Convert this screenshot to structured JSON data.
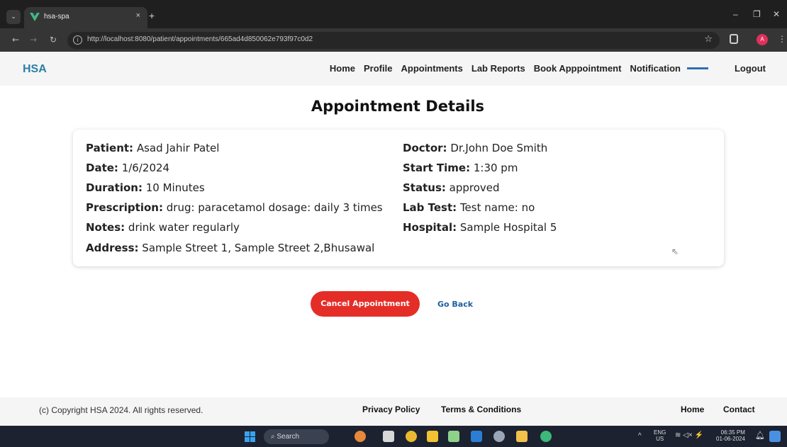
{
  "browser": {
    "tab_title": "hsa-spa",
    "tab_close": "×",
    "new_tab": "+",
    "url": "http://localhost:8080/patient/appointments/665ad4d850062e793f97c0d2",
    "profile_initial": "A",
    "accent_favicon": "#41b883"
  },
  "navbar": {
    "brand": "HSA",
    "links": {
      "home": "Home",
      "profile": "Profile",
      "appointments": "Appointments",
      "lab_reports": "Lab Reports",
      "book": "Book Apppointment",
      "notification": "Notification",
      "logout": "Logout"
    }
  },
  "page": {
    "title": "Appointment Details"
  },
  "details": {
    "patient_label": "Patient:",
    "patient": "Asad Jahir Patel",
    "date_label": "Date:",
    "date": "1/6/2024",
    "duration_label": "Duration:",
    "duration": "10 Minutes",
    "prescription_label": "Prescription:",
    "prescription": "drug: paracetamol dosage: daily 3 times",
    "notes_label": "Notes:",
    "notes": "drink water regularly",
    "address_label": "Address:",
    "address": "Sample Street 1, Sample Street 2,Bhusawal",
    "doctor_label": "Doctor:",
    "doctor": "Dr.John Doe Smith",
    "start_time_label": "Start Time:",
    "start_time": "1:30 pm",
    "status_label": "Status:",
    "status": "approved",
    "lab_test_label": "Lab Test:",
    "lab_test": "Test name: no",
    "hospital_label": "Hospital:",
    "hospital": "Sample Hospital 5"
  },
  "actions": {
    "cancel": "Cancel Appointment",
    "back": "Go Back"
  },
  "footer": {
    "copyright": "(c) Copyright HSA 2024. All rights reserved.",
    "privacy": "Privacy Policy",
    "terms": "Terms & Conditions",
    "home": "Home",
    "contact": "Contact"
  },
  "taskbar": {
    "search": "Search",
    "lang_1": "ENG",
    "lang_2": "US",
    "time": "06:35 PM",
    "date": "01-06-2024"
  },
  "colors": {
    "brand": "#2a7fa6",
    "cancel_button": "#e52d27",
    "back_link": "#1d5fa0"
  }
}
